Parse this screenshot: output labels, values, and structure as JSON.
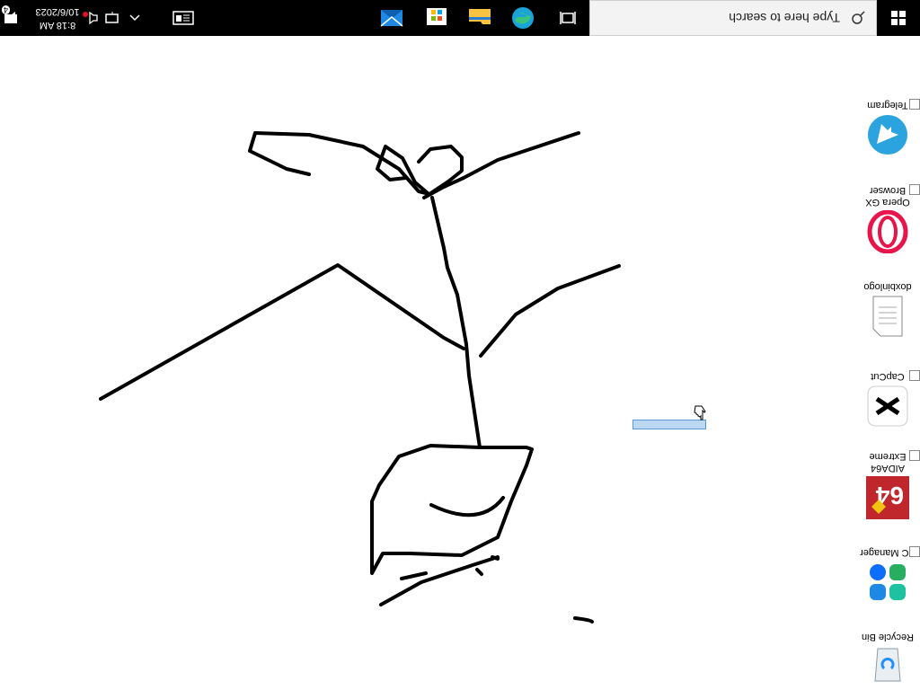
{
  "taskbar": {
    "search_placeholder": "Type here to search",
    "clock_time": "8:18 AM",
    "clock_date": "10/6/2023",
    "notification_count": "4"
  },
  "desktop_icons": [
    {
      "label": "Recycle Bin",
      "icon": "recycle-bin-icon"
    },
    {
      "label": "PC Manager",
      "icon": "pc-manager-icon"
    },
    {
      "label": "AIDA64 Extreme",
      "icon": "aida64-icon"
    },
    {
      "label": "CapCut",
      "icon": "capcut-icon"
    },
    {
      "label": "doxbinlogo",
      "icon": "text-file-icon"
    },
    {
      "label": "Opera GX Browser",
      "icon": "opera-gx-icon"
    },
    {
      "label": "Telegram",
      "icon": "telegram-icon"
    }
  ],
  "colors": {
    "taskbar_bg": "#000000",
    "desktop_bg": "#ffffff",
    "selection": "#bcd7f2"
  }
}
